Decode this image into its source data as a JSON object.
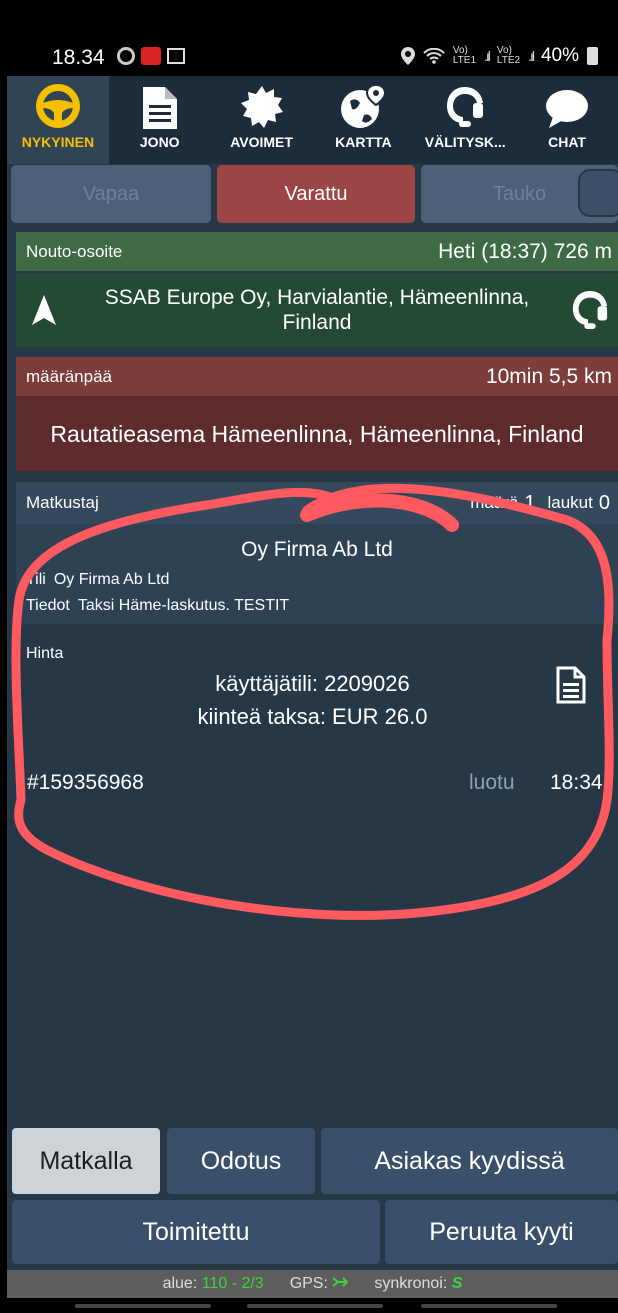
{
  "status_bar": {
    "time": "18.34",
    "net1": "Vo)\nLTE1",
    "net2": "Vo)\nLTE2",
    "battery": "40%"
  },
  "nav": {
    "tabs": [
      {
        "label": "NYKYINEN",
        "icon": "steering-wheel-icon",
        "active": true
      },
      {
        "label": "JONO",
        "icon": "document-icon"
      },
      {
        "label": "AVOIMET",
        "icon": "badge-icon"
      },
      {
        "label": "KARTTA",
        "icon": "globe-pin-icon"
      },
      {
        "label": "VÄLITYSK...",
        "icon": "headset-icon"
      },
      {
        "label": "CHAT",
        "icon": "chat-bubble-icon"
      }
    ]
  },
  "state_buttons": {
    "vapaa": "Vapaa",
    "varattu": "Varattu",
    "tauko": "Tauko"
  },
  "pickup": {
    "label": "Nouto-osoite",
    "eta": "Heti (18:37) 726 m",
    "address": "SSAB Europe Oy, Harvialantie, Hämeenlinna, Finland"
  },
  "destination": {
    "label": "määränpää",
    "eta": "10min 5,5 km",
    "address": "Rautatieasema Hämeenlinna, Hämeenlinna, Finland"
  },
  "passenger": {
    "label": "Matkustaj",
    "count_label": "määrä",
    "count": "1",
    "bags_label": "laukut",
    "bags": "0",
    "company": "Oy Firma Ab Ltd",
    "tili_label": "Tili",
    "tili_value": "Oy Firma Ab Ltd",
    "tiedot_label": "Tiedot",
    "tiedot_value": "Taksi Häme-laskutus. TESTIT"
  },
  "price": {
    "label": "Hinta",
    "account": "käyttäjätili: 2209026",
    "fixed": "kiinteä taksa: EUR 26.0"
  },
  "order": {
    "id": "#159356968",
    "created_label": "luotu",
    "created_time": "18:34"
  },
  "actions": {
    "matkalla": "Matkalla",
    "odotus": "Odotus",
    "asiakas": "Asiakas kyydissä",
    "toimitettu": "Toimitettu",
    "peruuta": "Peruuta kyyti"
  },
  "footer": {
    "alue_label": "alue:",
    "alue_value": "110 - 2/3",
    "gps_label": "GPS:",
    "sync_label": "synkronoi:",
    "sync_value": "S"
  },
  "colors": {
    "accent": "#f6c000",
    "background": "#263746",
    "pickup": "#3f6a46",
    "destination": "#7c3d3b",
    "annotation": "#ff5a5f"
  }
}
